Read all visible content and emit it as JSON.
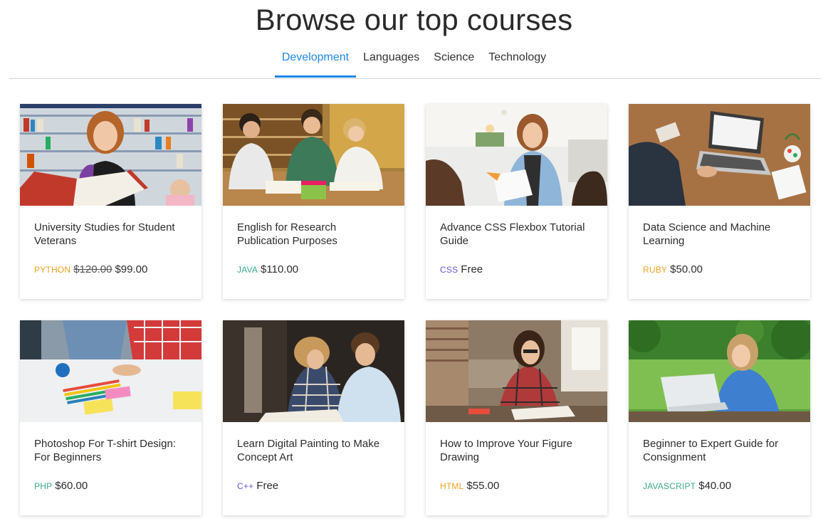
{
  "page": {
    "title": "Browse our top courses"
  },
  "tabs": [
    {
      "label": "Development",
      "active": true
    },
    {
      "label": "Languages",
      "active": false
    },
    {
      "label": "Science",
      "active": false
    },
    {
      "label": "Technology",
      "active": false
    }
  ],
  "courses": [
    {
      "title": "University Studies for Student Veterans",
      "tag": "PYTHON",
      "tag_color": "#f0a020",
      "old_price": "$120.00",
      "price": "$99.00",
      "image": "woman-reading-library-photo"
    },
    {
      "title": "English for Research Publication Purposes",
      "tag": "JAVA",
      "tag_color": "#3aaa8c",
      "old_price": "",
      "price": "$110.00",
      "image": "students-studying-table-photo"
    },
    {
      "title": "Advance CSS Flexbox Tutorial Guide",
      "tag": "CSS",
      "tag_color": "#6a55d6",
      "old_price": "",
      "price": "Free",
      "image": "woman-reading-paper-photo"
    },
    {
      "title": "Data Science and Machine Learning",
      "tag": "RUBY",
      "tag_color": "#f0a020",
      "old_price": "",
      "price": "$50.00",
      "image": "laptop-desk-photo"
    },
    {
      "title": "Photoshop For T-shirt Design: For Beginners",
      "tag": "PHP",
      "tag_color": "#3aaa8c",
      "old_price": "",
      "price": "$60.00",
      "image": "desk-pencils-photo"
    },
    {
      "title": "Learn Digital Painting to Make Concept Art",
      "tag": "C++",
      "tag_color": "#6a55d6",
      "old_price": "",
      "price": "Free",
      "image": "two-students-reading-photo"
    },
    {
      "title": "How to Improve Your Figure Drawing",
      "tag": "HTML",
      "tag_color": "#f0a020",
      "old_price": "",
      "price": "$55.00",
      "image": "student-writing-cafe-photo"
    },
    {
      "title": "Beginner to Expert Guide for Consignment",
      "tag": "JAVASCRIPT",
      "tag_color": "#3aaa8c",
      "old_price": "",
      "price": "$40.00",
      "image": "woman-laptop-outdoors-photo"
    }
  ]
}
